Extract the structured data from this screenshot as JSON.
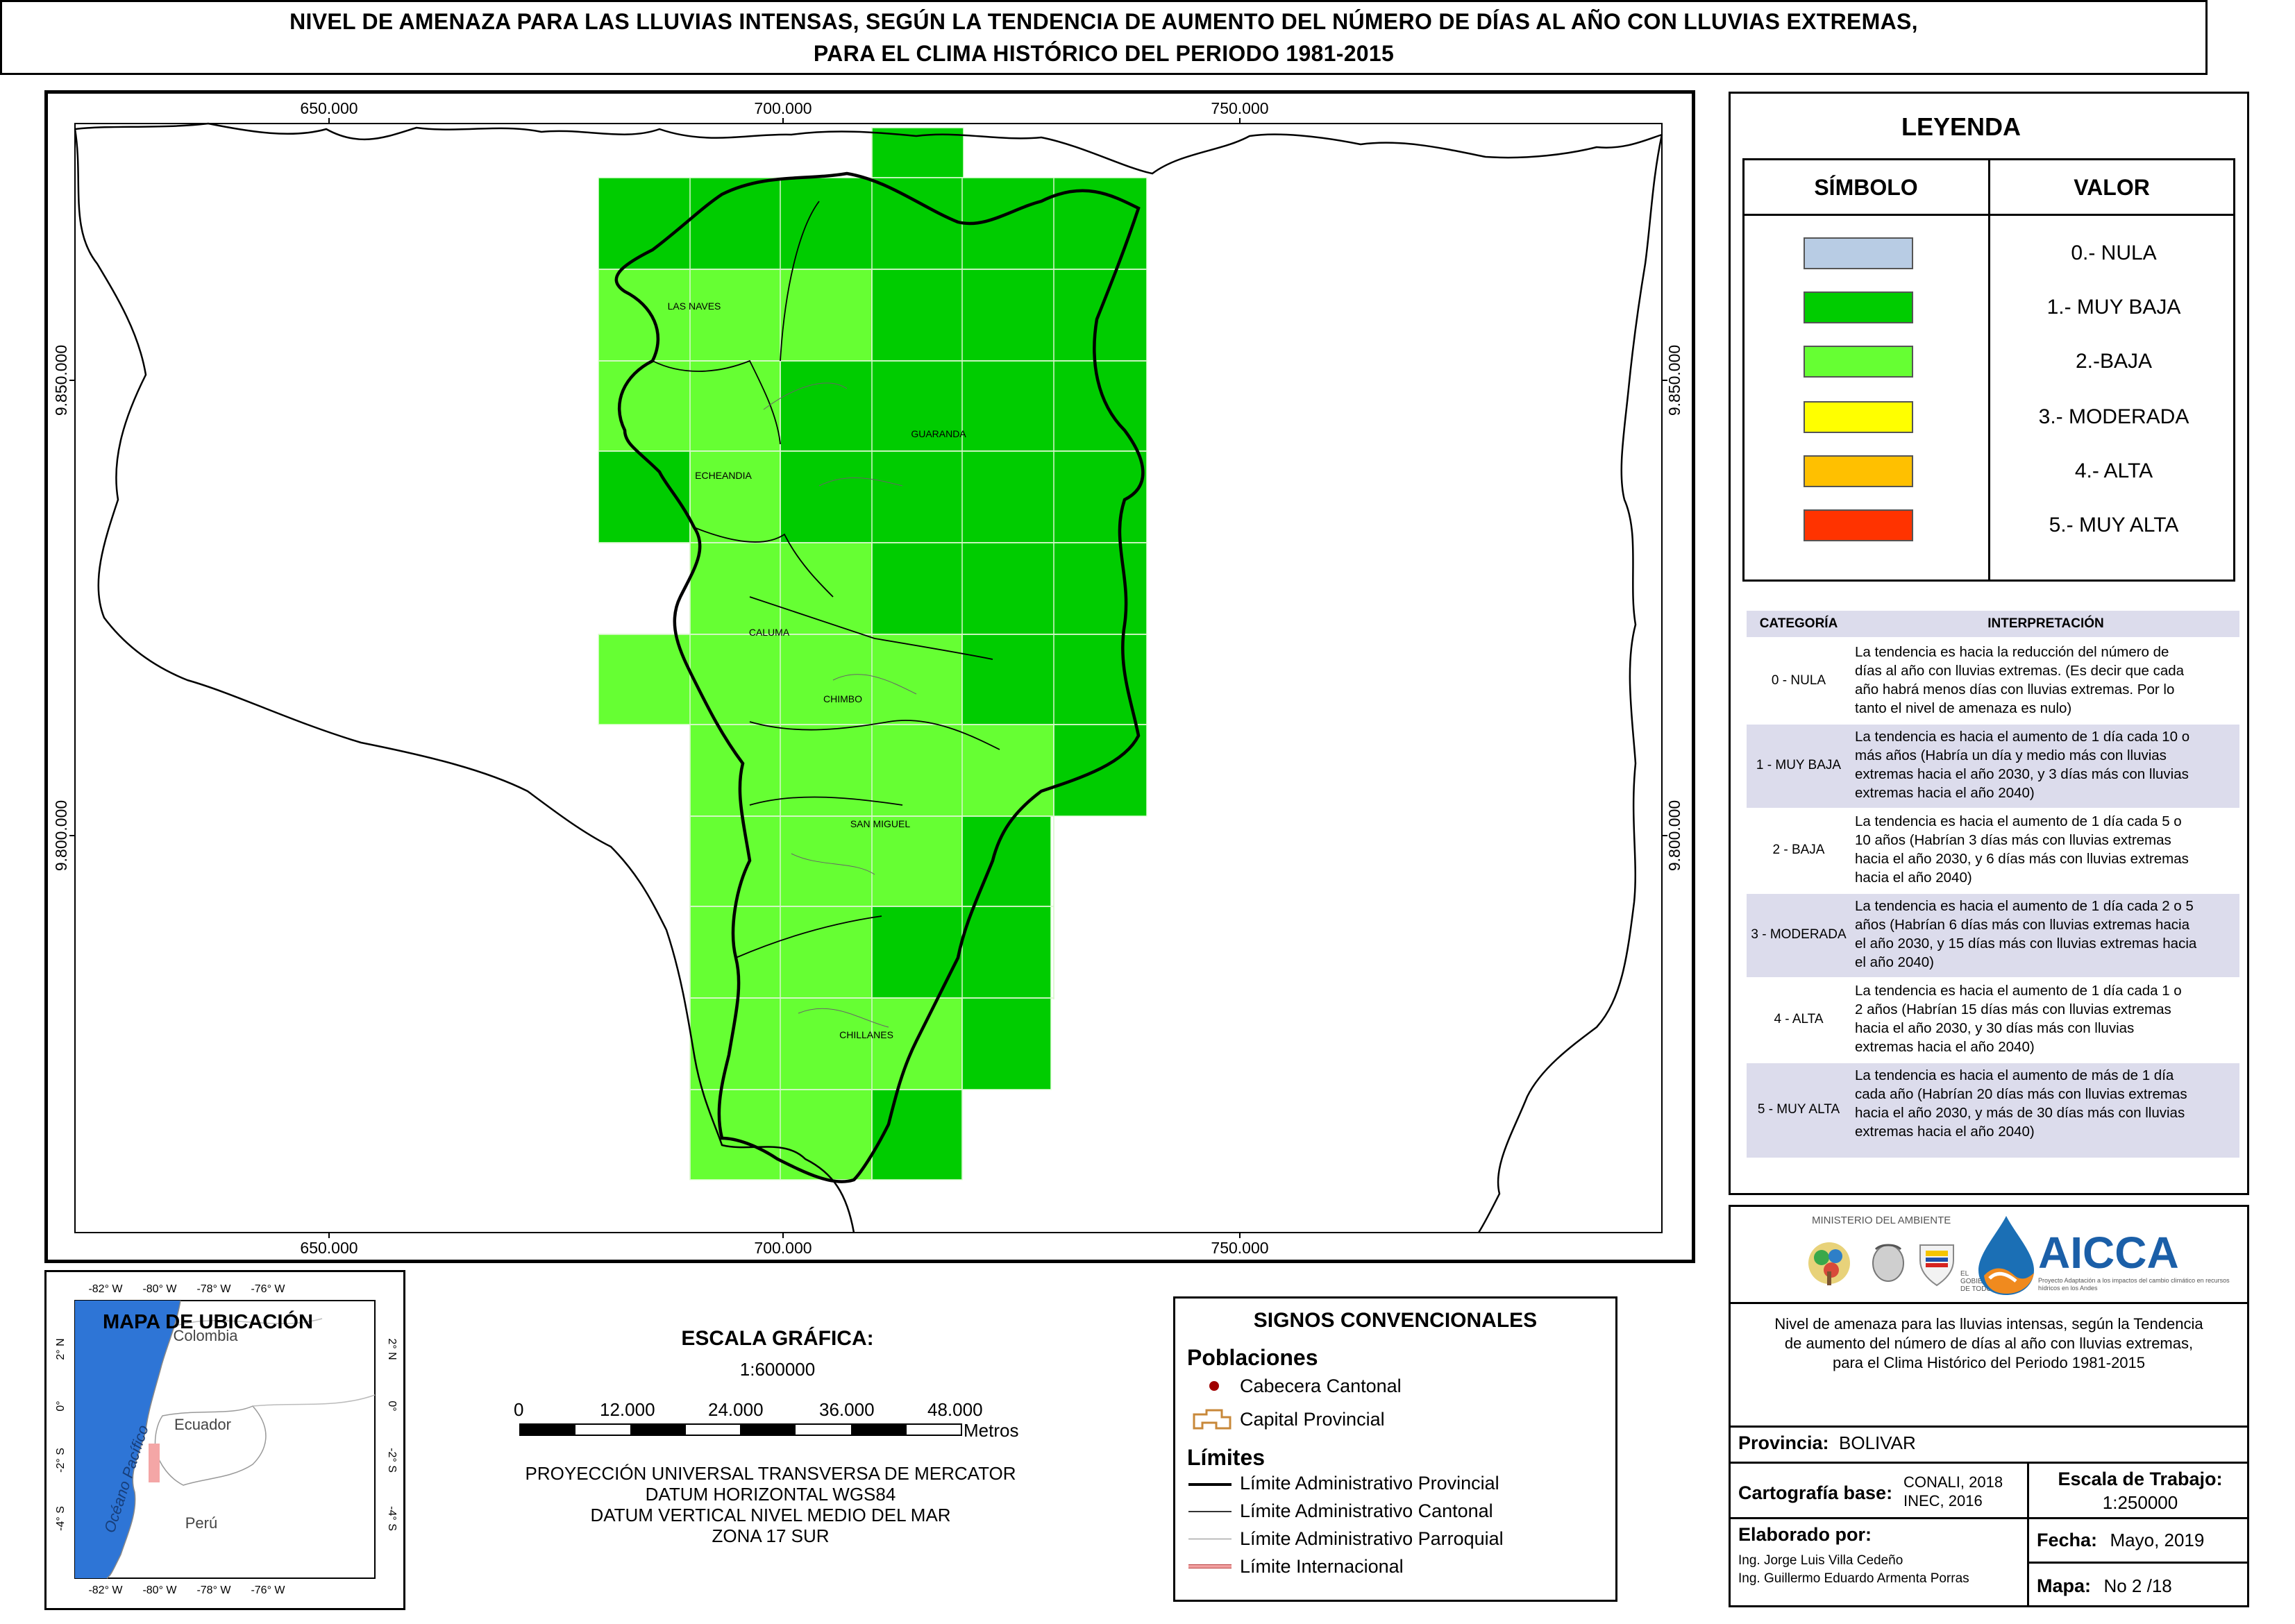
{
  "title": {
    "line1": "NIVEL DE AMENAZA PARA LAS LLUVIAS INTENSAS, SEGÚN LA TENDENCIA DE AUMENTO DEL NÚMERO DE DÍAS AL AÑO CON LLUVIAS EXTREMAS,",
    "line2": "PARA EL CLIMA HISTÓRICO DEL PERIODO 1981-2015"
  },
  "map": {
    "x_ticks": [
      "650.000",
      "700.000",
      "750.000"
    ],
    "y_ticks": [
      "9.850.000",
      "9.800.000"
    ],
    "places": [
      "LAS NAVES",
      "ECHEANDIA",
      "GUARANDA",
      "CALUMA",
      "CHIMBO",
      "SAN MIGUEL",
      "CHILLANES"
    ],
    "colors": {
      "muy_baja": "#00cc00",
      "baja": "#66ff33",
      "outline": "#000000"
    }
  },
  "legend": {
    "title": "LEYENDA",
    "col_symbol": "SÍMBOLO",
    "col_value": "VALOR",
    "items": [
      {
        "label": "0.- NULA",
        "color": "#b8cce4"
      },
      {
        "label": "1.- MUY BAJA",
        "color": "#00cc00"
      },
      {
        "label": "2.-BAJA",
        "color": "#66ff33"
      },
      {
        "label": "3.- MODERADA",
        "color": "#ffff00"
      },
      {
        "label": "4.- ALTA",
        "color": "#ffc000"
      },
      {
        "label": "5.- MUY ALTA",
        "color": "#ff3300"
      }
    ]
  },
  "categories": {
    "col_category": "CATEGORÍA",
    "col_interpretation": "INTERPRETACIÓN",
    "rows": [
      {
        "name": "0 - NULA",
        "lines": [
          "La tendencia es hacia la reducción del número de",
          "días al año con lluvias extremas. (Es decir que cada",
          "año habrá menos días con lluvias extremas. Por lo",
          "tanto el nivel de amenaza es nulo)"
        ]
      },
      {
        "name": "1 - MUY BAJA",
        "lines": [
          "La tendencia es hacia el aumento de 1 día cada 10 o",
          "más años (Habría un día y medio más con lluvias",
          "extremas hacia el año 2030, y 3 días más con lluvias",
          "extremas hacia el año 2040)"
        ]
      },
      {
        "name": "2 - BAJA",
        "lines": [
          "La tendencia es hacia el aumento de 1 día cada 5 o",
          "10 años (Habrían 3 días más con lluvias extremas",
          "hacia el año 2030, y 6 días más con lluvias extremas",
          "hacia el año 2040)"
        ]
      },
      {
        "name": "3 - MODERADA",
        "lines": [
          "La tendencia es hacia el aumento de 1 día cada 2 o 5",
          "años (Habrían 6 días más con lluvias extremas hacia",
          "el año 2030, y 15 días más con lluvias extremas hacia",
          "el año 2040)"
        ]
      },
      {
        "name": "4 - ALTA",
        "lines": [
          "La tendencia es hacia el aumento de 1 día cada 1 o",
          "2 años (Habrían 15 días más con lluvias extremas",
          "hacia el año 2030, y 30 días más con lluvias",
          "extremas hacia el año 2040)"
        ]
      },
      {
        "name": "5 - MUY ALTA",
        "lines": [
          "La tendencia es hacia el aumento de más de 1 día",
          "cada año (Habrían 20 días más con lluvias extremas",
          "hacia el año 2030, y más de 30 días más con lluvias",
          "extremas hacia el año 2040)"
        ]
      }
    ]
  },
  "location_map": {
    "title": "MAPA DE UBICACIÓN",
    "lon_ticks": [
      "-82° W",
      "-80° W",
      "-78° W",
      "-76° W"
    ],
    "lat_ticks": [
      "2° N",
      "0°",
      "-2° S",
      "-4° S"
    ],
    "labels": {
      "colombia": "Colombia",
      "ecuador": "Ecuador",
      "peru": "Perú",
      "ocean": "Océano Pacífico"
    }
  },
  "scale": {
    "title": "ESCALA GRÁFICA:",
    "ratio": "1:600000",
    "ticks": [
      "0",
      "12.000",
      "24.000",
      "36.000",
      "48.000"
    ],
    "unit": "Metros",
    "projection": [
      "PROYECCIÓN UNIVERSAL TRANSVERSA DE MERCATOR",
      "DATUM HORIZONTAL WGS84",
      "DATUM VERTICAL NIVEL MEDIO DEL MAR",
      "ZONA 17 SUR"
    ]
  },
  "signs": {
    "title": "SIGNOS CONVENCIONALES",
    "poblaciones": "Poblaciones",
    "cabecera": "Cabecera Cantonal",
    "capital": "Capital Provincial",
    "limites": "Límites",
    "lim_provincial": "Límite Administrativo Provincial",
    "lim_cantonal": "Límite Administrativo Cantonal",
    "lim_parroquial": "Límite Administrativo Parroquial",
    "lim_internacional": "Límite Internacional"
  },
  "info": {
    "ministry": "MINISTERIO DEL AMBIENTE",
    "gobierno": "EL GOBIERNO DE TODOS",
    "aicca": "AICCA",
    "aicca_sub": "Proyecto Adaptación a los impactos del cambio climático en recursos hídricos en los Andes",
    "description": [
      "Nivel de amenaza para las lluvias intensas, según la Tendencia",
      "de aumento del número de días al año con lluvias extremas,",
      "para el Clima Histórico del Periodo 1981-2015"
    ],
    "provincia_label": "Provincia:",
    "provincia": "BOLIVAR",
    "cartografia_label": "Cartografía base:",
    "cartografia": [
      "CONALI, 2018",
      "INEC, 2016"
    ],
    "escala_label": "Escala de Trabajo:",
    "escala": "1:250000",
    "elaborado_label": "Elaborado por:",
    "elaborado": [
      "Ing. Jorge Luis Villa Cedeño",
      "Ing. Guillermo Eduardo Armenta Porras"
    ],
    "fecha_label": "Fecha:",
    "fecha": "Mayo, 2019",
    "mapa_label": "Mapa:",
    "mapa": "No 2 /18"
  }
}
